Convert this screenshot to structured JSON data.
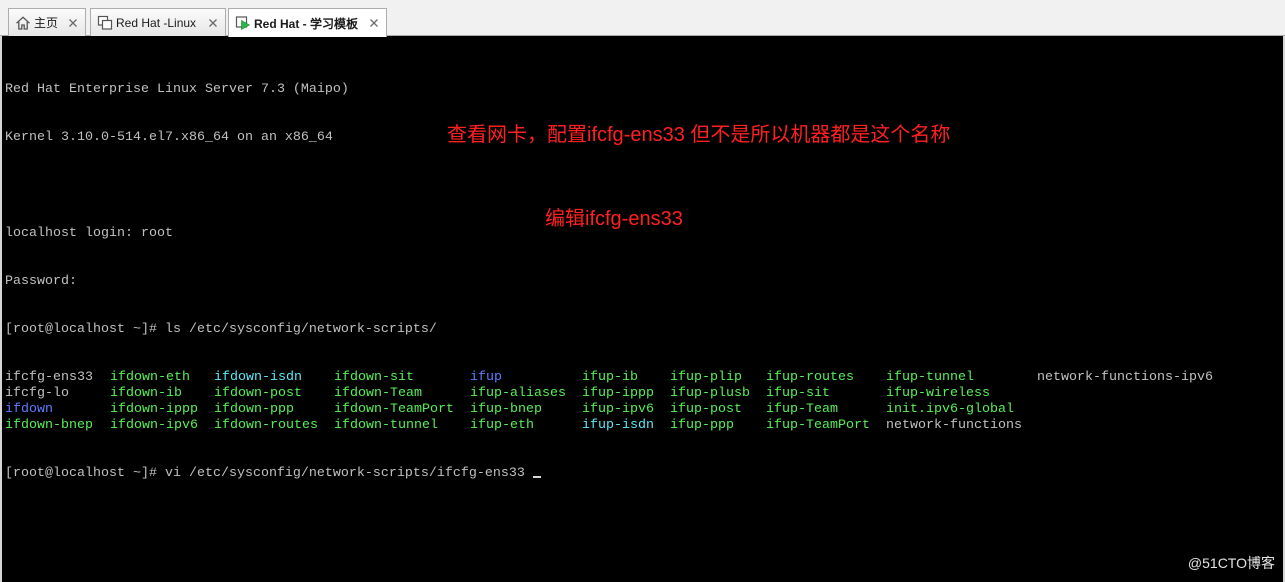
{
  "tabs": [
    {
      "label": "主页",
      "icon": "home-icon",
      "close_icon": "close-icon",
      "active": false
    },
    {
      "label": "Red Hat -Linux",
      "icon": "vm-icon",
      "close_icon": "close-icon",
      "active": false
    },
    {
      "label": "Red Hat - 学习模板",
      "icon": "vm-running-icon",
      "close_icon": "close-icon",
      "active": true
    }
  ],
  "terminal": {
    "boot_lines": [
      "Red Hat Enterprise Linux Server 7.3 (Maipo)",
      "Kernel 3.10.0-514.el7.x86_64 on an x86_64",
      "localhost login: root",
      "Password:"
    ],
    "ls_command": "[root@localhost ~]# ls /etc/sysconfig/network-scripts/",
    "ls_output": [
      [
        {
          "name": "ifcfg-ens33",
          "color": "#c0c0c0"
        },
        {
          "name": "ifdown-eth",
          "color": "#55f055"
        },
        {
          "name": "ifdown-isdn",
          "color": "#5ce8f8"
        },
        {
          "name": "ifdown-sit",
          "color": "#55f055"
        },
        {
          "name": "ifup",
          "color": "#5c7cff"
        },
        {
          "name": "ifup-ib",
          "color": "#55f055"
        },
        {
          "name": "ifup-plip",
          "color": "#55f055"
        },
        {
          "name": "ifup-routes",
          "color": "#55f055"
        },
        {
          "name": "ifup-tunnel",
          "color": "#55f055"
        },
        {
          "name": "network-functions-ipv6",
          "color": "#c0c0c0"
        }
      ],
      [
        {
          "name": "ifcfg-lo",
          "color": "#c0c0c0"
        },
        {
          "name": "ifdown-ib",
          "color": "#55f055"
        },
        {
          "name": "ifdown-post",
          "color": "#55f055"
        },
        {
          "name": "ifdown-Team",
          "color": "#55f055"
        },
        {
          "name": "ifup-aliases",
          "color": "#55f055"
        },
        {
          "name": "ifup-ippp",
          "color": "#55f055"
        },
        {
          "name": "ifup-plusb",
          "color": "#55f055"
        },
        {
          "name": "ifup-sit",
          "color": "#55f055"
        },
        {
          "name": "ifup-wireless",
          "color": "#55f055"
        }
      ],
      [
        {
          "name": "ifdown",
          "color": "#5c7cff"
        },
        {
          "name": "ifdown-ippp",
          "color": "#55f055"
        },
        {
          "name": "ifdown-ppp",
          "color": "#55f055"
        },
        {
          "name": "ifdown-TeamPort",
          "color": "#55f055"
        },
        {
          "name": "ifup-bnep",
          "color": "#55f055"
        },
        {
          "name": "ifup-ipv6",
          "color": "#55f055"
        },
        {
          "name": "ifup-post",
          "color": "#55f055"
        },
        {
          "name": "ifup-Team",
          "color": "#55f055"
        },
        {
          "name": "init.ipv6-global",
          "color": "#55f055"
        }
      ],
      [
        {
          "name": "ifdown-bnep",
          "color": "#55f055"
        },
        {
          "name": "ifdown-ipv6",
          "color": "#55f055"
        },
        {
          "name": "ifdown-routes",
          "color": "#55f055"
        },
        {
          "name": "ifdown-tunnel",
          "color": "#55f055"
        },
        {
          "name": "ifup-eth",
          "color": "#55f055"
        },
        {
          "name": "ifup-isdn",
          "color": "#5ce8f8"
        },
        {
          "name": "ifup-ppp",
          "color": "#55f055"
        },
        {
          "name": "ifup-TeamPort",
          "color": "#55f055"
        },
        {
          "name": "network-functions",
          "color": "#c0c0c0"
        }
      ]
    ],
    "vi_command": "[root@localhost ~]# vi /etc/sysconfig/network-scripts/ifcfg-ens33"
  },
  "annotations": {
    "ls_note": "查看网卡，配置ifcfg-ens33 但不是所以机器都是这个名称",
    "vi_note": "编辑ifcfg-ens33"
  },
  "watermark": "@51CTO博客",
  "colors": {
    "terminal_bg": "#000000",
    "terminal_text": "#c0c0c0",
    "annotation": "#ff2020",
    "watermark": "#e4e4e4"
  }
}
